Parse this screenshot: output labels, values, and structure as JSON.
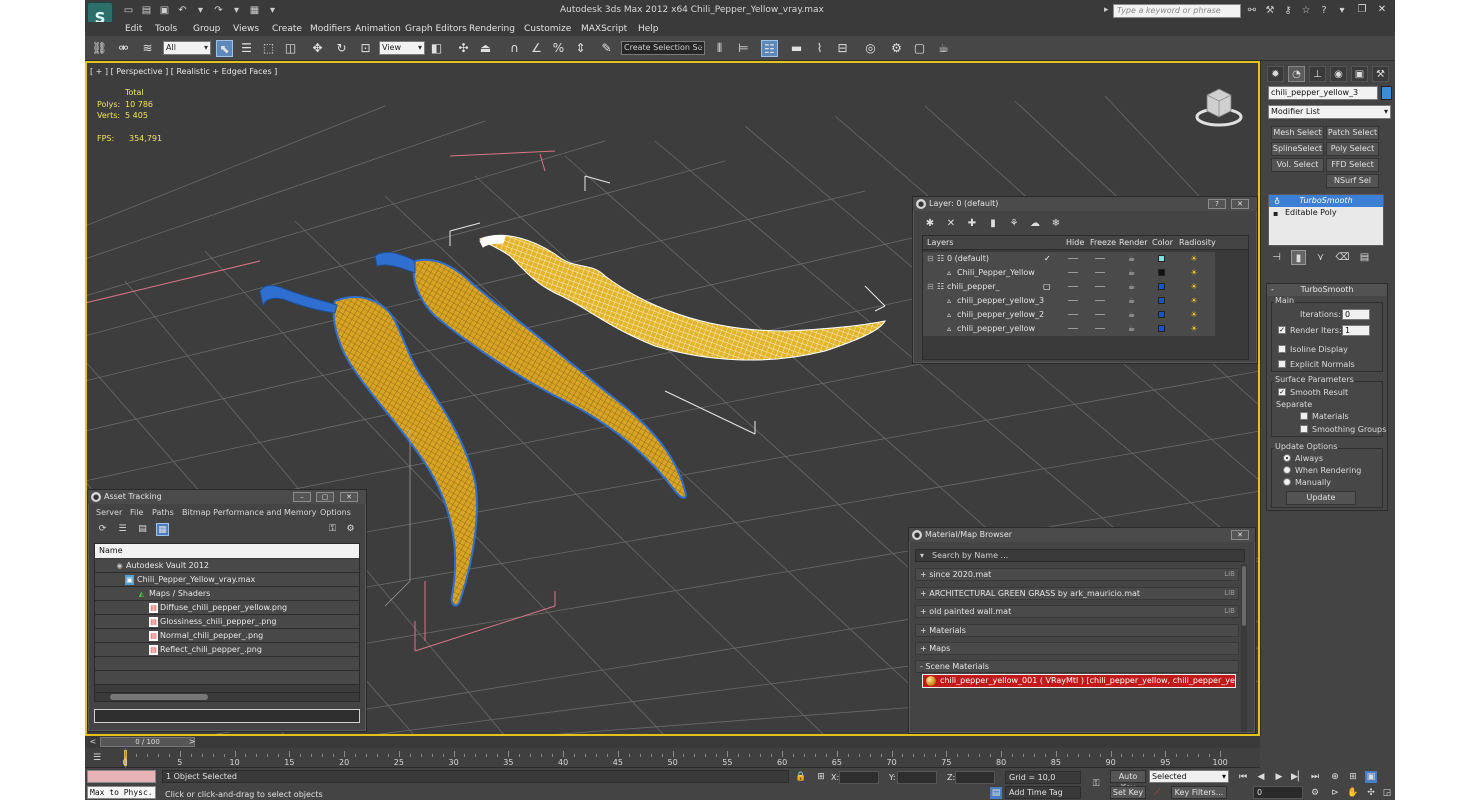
{
  "app": {
    "logo": "S",
    "title": "Autodesk 3ds Max  2012 x64     Chili_Pepper_Yellow_vray.max",
    "search_placeholder": "Type a keyword or phrase"
  },
  "menu": [
    "Edit",
    "Tools",
    "Group",
    "Views",
    "Create",
    "Modifiers",
    "Animation",
    "Graph Editors",
    "Rendering",
    "Customize",
    "MAXScript",
    "Help"
  ],
  "toolbar": {
    "selection_filter": "All",
    "reference_coord": "View",
    "named_selection": "Create Selection Se"
  },
  "viewport": {
    "label": "[ + ] [ Perspective ] [ Realistic + Edged Faces ]",
    "stats": {
      "header": "Total",
      "polys_label": "Polys:",
      "polys": "10 786",
      "verts_label": "Verts:",
      "verts": "5 405",
      "fps_label": "FPS:",
      "fps": "354,791"
    },
    "axis_z": "z"
  },
  "command_panel": {
    "object_name": "chili_pepper_yellow_3",
    "object_color": "#3c8dd8",
    "modifier_list": "Modifier List",
    "buttons": [
      "Mesh Select",
      "Patch Select",
      "SplineSelect",
      "Poly Select",
      "Vol. Select",
      "FFD Select",
      "NSurf Sel"
    ],
    "stack": [
      "TurboSmooth",
      "Editable Poly"
    ],
    "turbosmooth": {
      "title": "TurboSmooth",
      "main": "Main",
      "iterations_label": "Iterations:",
      "iterations": "0",
      "render_iters_label": "Render Iters:",
      "render_iters": "1",
      "isoline": "Isoline Display",
      "explicit": "Explicit Normals",
      "surface_params": "Surface Parameters",
      "smooth_result": "Smooth Result",
      "separate": "Separate",
      "materials": "Materials",
      "smoothing_groups": "Smoothing Groups",
      "update_options": "Update Options",
      "always": "Always",
      "when_rendering": "When Rendering",
      "manually": "Manually",
      "update": "Update"
    }
  },
  "layer_window": {
    "title": "Layer: 0 (default)",
    "help": "?",
    "columns": [
      "Layers",
      "Hide",
      "Freeze",
      "Render",
      "Color",
      "Radiosity"
    ],
    "rows": [
      {
        "name": "0 (default)",
        "color": "#7fe0d8"
      },
      {
        "name": "Chili_Pepper_Yellow",
        "color": "#111111"
      },
      {
        "name": "chili_pepper_",
        "color": "#1a52c8"
      },
      {
        "name": "chili_pepper_yellow_3",
        "color": "#1a52c8"
      },
      {
        "name": "chili_pepper_yellow_2",
        "color": "#1a52c8"
      },
      {
        "name": "chili_pepper_yellow",
        "color": "#1a52c8"
      }
    ]
  },
  "asset_tracking": {
    "title": "Asset Tracking",
    "menu": [
      "Server",
      "File",
      "Paths",
      "Bitmap Performance and Memory",
      "Options"
    ],
    "column": "Name",
    "rows": [
      "Autodesk Vault 2012",
      "Chili_Pepper_Yellow_vray.max",
      "Maps / Shaders",
      "Diffuse_chili_pepper_yellow.png",
      "Glossiness_chili_pepper_.png",
      "Normal_chili_pepper_.png",
      "Reflect_chili_pepper_.png"
    ]
  },
  "material_browser": {
    "title": "Material/Map Browser",
    "search": "Search by Name ...",
    "libraries": [
      {
        "label": "+ since 2020.mat",
        "tag": "LIB"
      },
      {
        "label": "+ ARCHITECTURAL GREEN GRASS by ark_mauricio.mat",
        "tag": "LIB"
      },
      {
        "label": "+ old painted wall.mat",
        "tag": "LIB"
      },
      {
        "label": "+ Materials",
        "tag": ""
      },
      {
        "label": "+ Maps",
        "tag": ""
      },
      {
        "label": "- Scene Materials",
        "tag": ""
      }
    ],
    "scene_material": "chili_pepper_yellow_001  ( VRayMtl ) [chili_pepper_yellow, chili_pepper_yellow_2, chili_pepper_yellow_3]"
  },
  "timeline": {
    "frame": "0 / 100",
    "ticks": [
      "0",
      "5",
      "10",
      "15",
      "20",
      "25",
      "30",
      "35",
      "40",
      "45",
      "50",
      "55",
      "60",
      "65",
      "70",
      "75",
      "80",
      "85",
      "90",
      "95",
      "100"
    ]
  },
  "status": {
    "maxscript": "Max to Physc.",
    "selected": "1 Object Selected",
    "prompt": "Click or click-and-drag to select objects",
    "x_label": "X:",
    "y_label": "Y:",
    "z_label": "Z:",
    "grid": "Grid = 10,0",
    "add_time_tag": "Add Time Tag",
    "auto_key": "Auto Key",
    "set_key": "Set Key",
    "key_mode": "Selected",
    "key_filters": "Key Filters...",
    "frame_field": "0"
  }
}
